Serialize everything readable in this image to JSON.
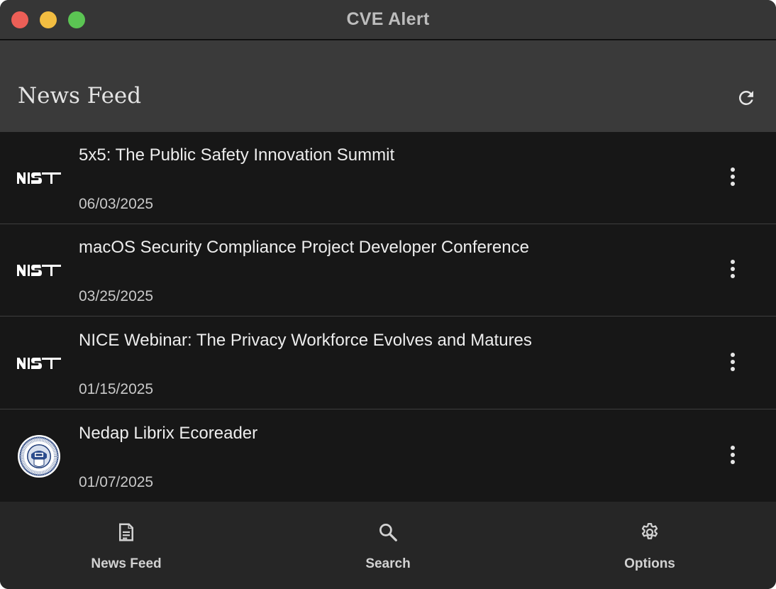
{
  "window": {
    "title": "CVE Alert"
  },
  "colors": {
    "titlebar": "#363636",
    "appbar": "#3a3a3a",
    "feed_background": "#171717",
    "bottom_nav": "#262626",
    "close": "#ec5f57",
    "minimize": "#f2bd41",
    "zoom": "#5bc453"
  },
  "header": {
    "title": "News Feed",
    "refresh_icon": "refresh-icon"
  },
  "feed": {
    "items": [
      {
        "title": "5x5: The Public Safety Innovation Summit",
        "date": "06/03/2025",
        "source_logo": "nist-logo"
      },
      {
        "title": "macOS Security Compliance Project Developer Conference",
        "date": "03/25/2025",
        "source_logo": "nist-logo"
      },
      {
        "title": "NICE Webinar: The Privacy Workforce Evolves and Matures",
        "date": "01/15/2025",
        "source_logo": "nist-logo"
      },
      {
        "title": "Nedap Librix Ecoreader",
        "date": "01/07/2025",
        "source_logo": "cisa-seal-logo"
      }
    ],
    "item_menu_icon": "more-vertical-icon"
  },
  "nav": {
    "items": [
      {
        "label": "News Feed",
        "icon": "document-icon"
      },
      {
        "label": "Search",
        "icon": "search-icon"
      },
      {
        "label": "Options",
        "icon": "gear-icon"
      }
    ]
  }
}
